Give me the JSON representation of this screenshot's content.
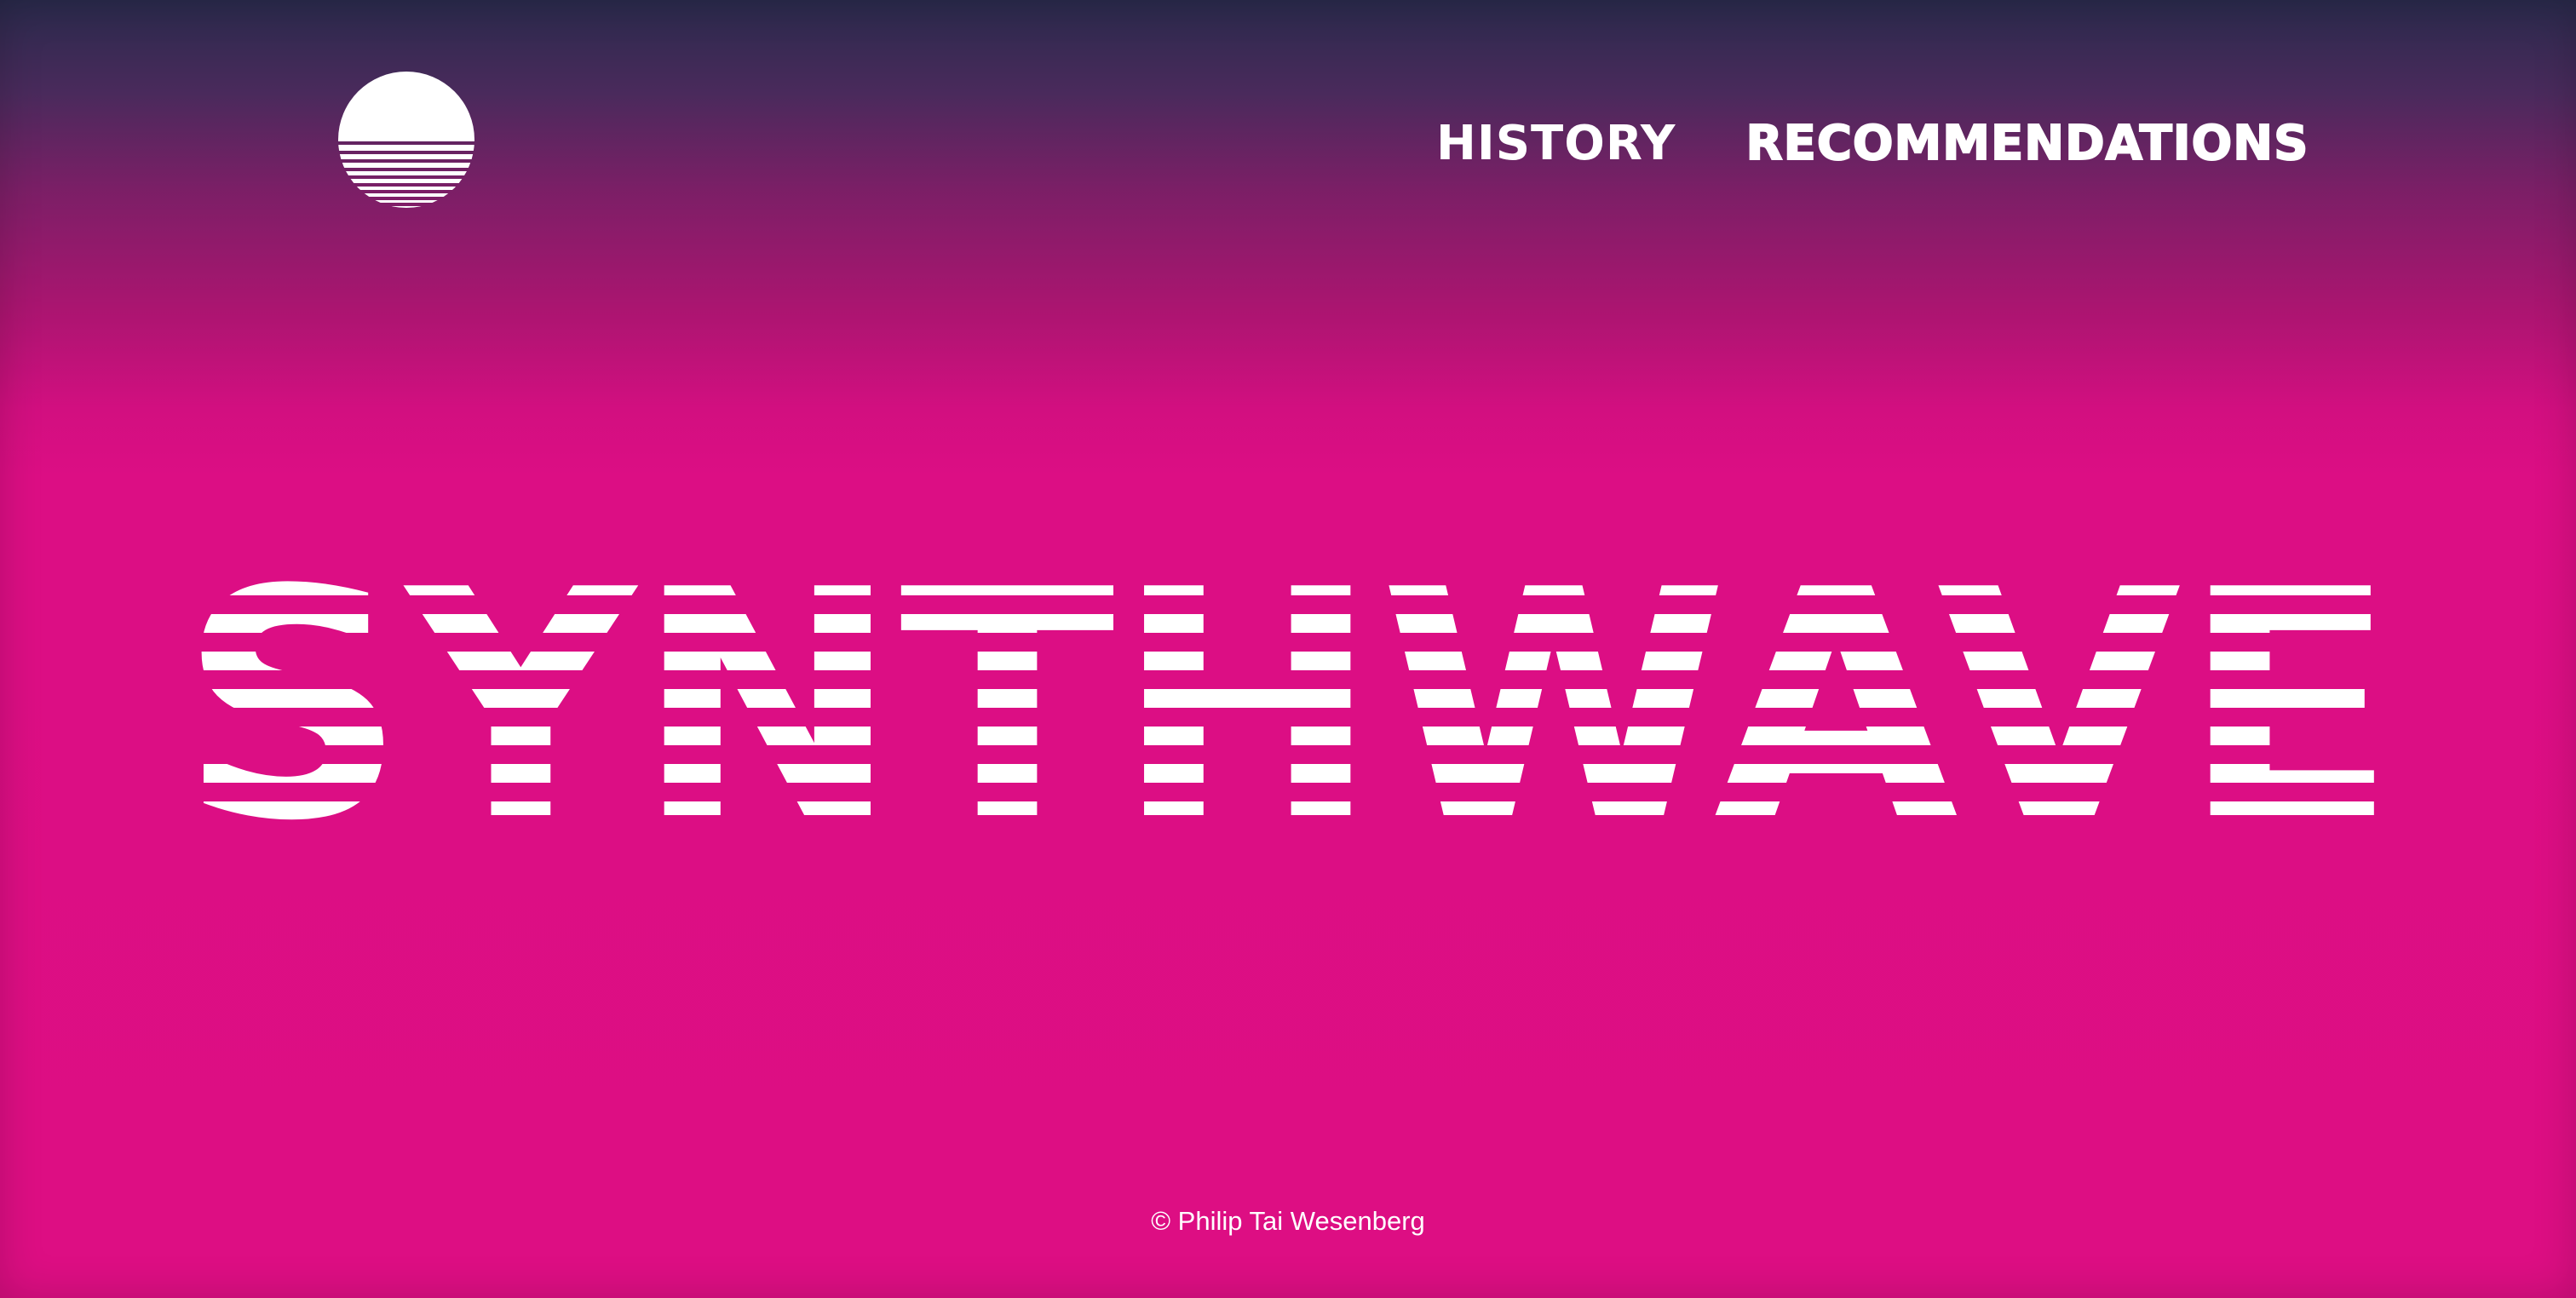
{
  "page": {
    "background_top": "#2a2a4c",
    "background_main": "#dd0e83",
    "accent": "#ffffff"
  },
  "header": {
    "logo_icon": "sunset-stripes-icon",
    "nav": [
      {
        "label": "HISTORY"
      },
      {
        "label": "RECOMMENDATIONS"
      }
    ]
  },
  "hero": {
    "title": "SYNTHWAVE",
    "style": "horizontal-stripes"
  },
  "footer": {
    "copyright": "© Philip Tai Wesenberg"
  }
}
